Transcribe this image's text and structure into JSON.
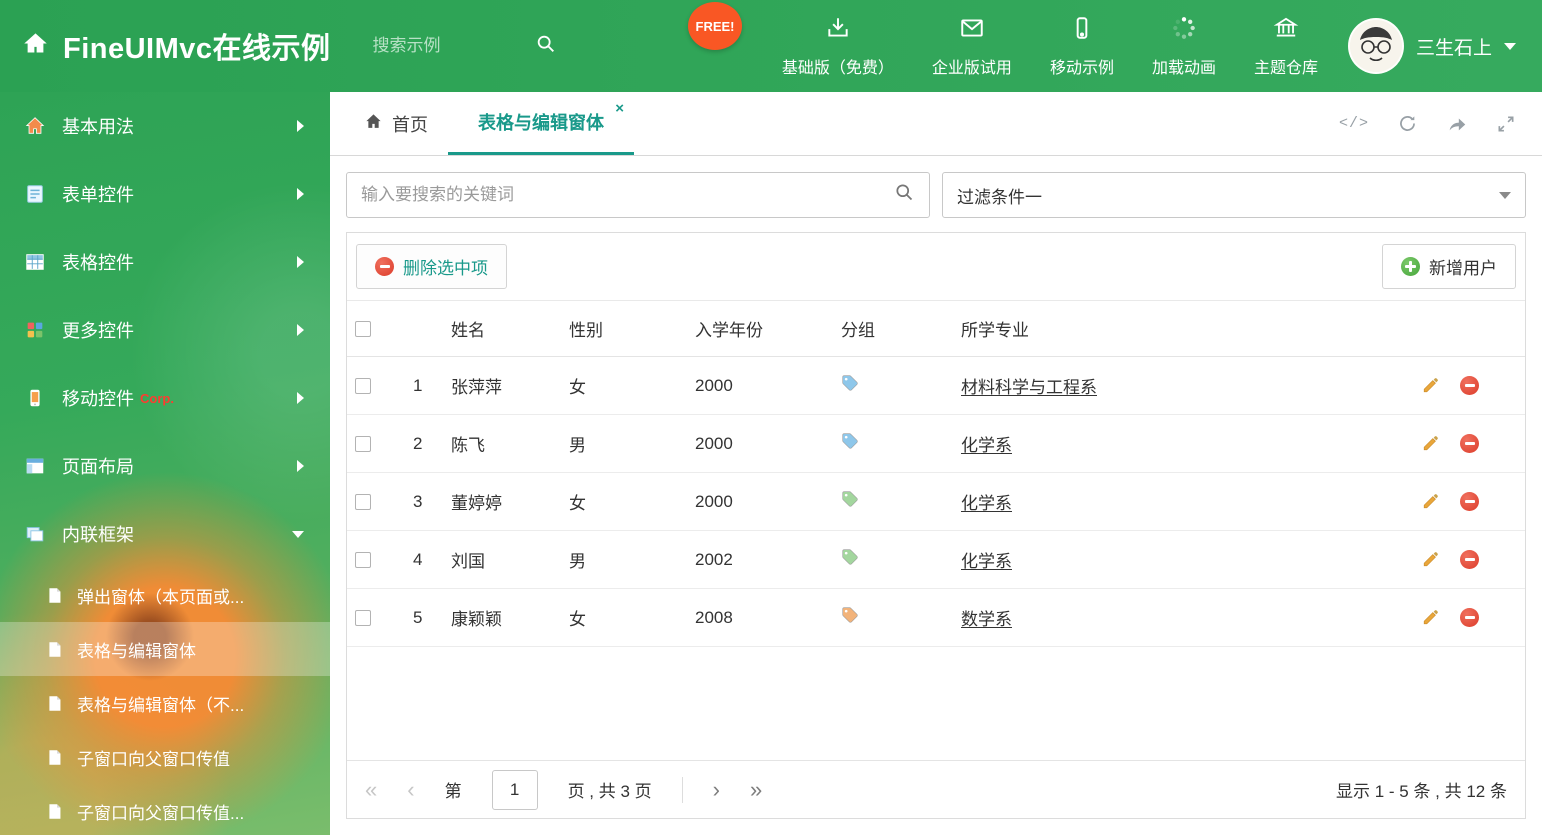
{
  "header": {
    "title": "FineUIMvc在线示例",
    "search_placeholder": "搜索示例",
    "free_badge": "FREE!",
    "nav": [
      {
        "label": "基础版（免费）"
      },
      {
        "label": "企业版试用"
      },
      {
        "label": "移动示例"
      },
      {
        "label": "加载动画"
      },
      {
        "label": "主题仓库"
      }
    ],
    "user_name": "三生石上"
  },
  "sidebar": {
    "items": [
      {
        "label": "基本用法"
      },
      {
        "label": "表单控件"
      },
      {
        "label": "表格控件"
      },
      {
        "label": "更多控件"
      },
      {
        "label": "移动控件",
        "badge": "Corp."
      },
      {
        "label": "页面布局"
      },
      {
        "label": "内联框架"
      }
    ],
    "subitems": [
      {
        "label": "弹出窗体（本页面或..."
      },
      {
        "label": "表格与编辑窗体"
      },
      {
        "label": "表格与编辑窗体（不..."
      },
      {
        "label": "子窗口向父窗口传值"
      },
      {
        "label": "子窗口向父窗口传值..."
      }
    ]
  },
  "tabs": {
    "home": "首页",
    "active": "表格与编辑窗体",
    "close_glyph": "×"
  },
  "tab_tools": {
    "code_glyph": "</>"
  },
  "filters": {
    "search_placeholder": "输入要搜索的关键词",
    "dropdown_value": "过滤条件一"
  },
  "grid": {
    "delete_button": "删除选中项",
    "add_button": "新增用户",
    "columns": {
      "name": "姓名",
      "gender": "性别",
      "year": "入学年份",
      "group": "分组",
      "major": "所学专业"
    },
    "rows": [
      {
        "index": "1",
        "name": "张萍萍",
        "gender": "女",
        "year": "2000",
        "tag_color": "#8ec7ea",
        "major": "材料科学与工程系"
      },
      {
        "index": "2",
        "name": "陈飞",
        "gender": "男",
        "year": "2000",
        "tag_color": "#8ec7ea",
        "major": "化学系"
      },
      {
        "index": "3",
        "name": "董婷婷",
        "gender": "女",
        "year": "2000",
        "tag_color": "#a3d69e",
        "major": "化学系"
      },
      {
        "index": "4",
        "name": "刘国",
        "gender": "男",
        "year": "2002",
        "tag_color": "#a3d69e",
        "major": "化学系"
      },
      {
        "index": "5",
        "name": "康颖颖",
        "gender": "女",
        "year": "2008",
        "tag_color": "#f2b37a",
        "major": "数学系"
      }
    ]
  },
  "pagination": {
    "prefix": "第",
    "page_value": "1",
    "suffix": "页 , 共 3 页",
    "first_glyph": "«",
    "prev_glyph": "‹",
    "next_glyph": "›",
    "last_glyph": "»",
    "summary": "显示 1 - 5 条 , 共 12 条"
  },
  "colors": {
    "header_green": "#2ba153",
    "accent_teal": "#19998a",
    "free_badge_orange": "#f95724",
    "delete_red": "#dc3c2a",
    "add_green": "#45a53a",
    "pencil_orange": "#e9a63a",
    "corp_badge_red": "#ff3b30"
  }
}
